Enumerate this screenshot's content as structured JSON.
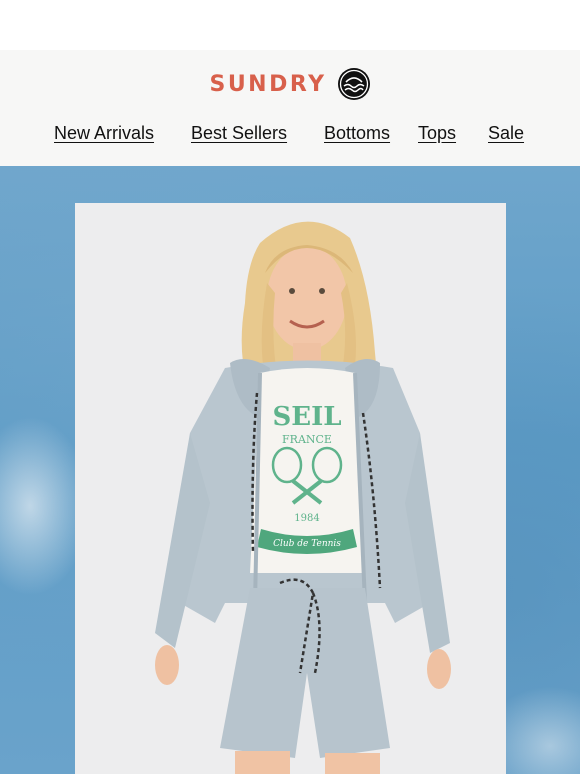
{
  "brand": {
    "name": "SUNDRY",
    "logo_icon": "wave-circle-icon",
    "colors": {
      "brand_red": "#d8604b",
      "header_bg": "#f7f7f6",
      "hero_blue": "#5e9cc6"
    }
  },
  "nav": {
    "items": [
      {
        "label": "New Arrivals"
      },
      {
        "label": "Best Sellers"
      },
      {
        "label": "Bottoms"
      },
      {
        "label": "Tops"
      },
      {
        "label": "Sale"
      }
    ]
  },
  "hero": {
    "image": "product-photo-model-in-light-blue-hoodie-and-shorts",
    "tee_print": {
      "line1": "SEIL",
      "line2": "FRANCE",
      "year": "1984",
      "banner": "Club de Tennis"
    }
  }
}
